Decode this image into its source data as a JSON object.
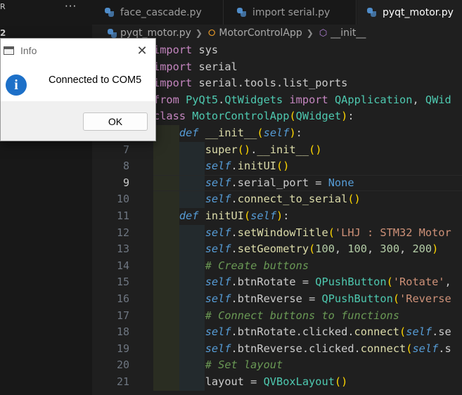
{
  "sidebar": {
    "title": "R",
    "more": "···",
    "badge": "2"
  },
  "tabs": [
    {
      "label": "face_cascade.py",
      "active": false
    },
    {
      "label": "import serial.py",
      "active": false
    },
    {
      "label": "pyqt_motor.py",
      "active": true
    }
  ],
  "breadcrumb": {
    "file": "pyqt_motor.py",
    "class": "MotorControlApp",
    "method": "__init__"
  },
  "editor": {
    "current_line": 9,
    "lines": [
      {
        "n": "",
        "text": "import sys"
      },
      {
        "n": "",
        "text": "import serial"
      },
      {
        "n": "",
        "text": "import serial.tools.list_ports"
      },
      {
        "n": "",
        "text": "from PyQt5.QtWidgets import QApplication, QWid"
      },
      {
        "n": "",
        "text": "class MotorControlApp(QWidget):"
      },
      {
        "n": "",
        "text": "    def __init__(self):"
      },
      {
        "n": "7",
        "text": "        super().__init__()"
      },
      {
        "n": "8",
        "text": "        self.initUI()"
      },
      {
        "n": "9",
        "text": "        self.serial_port = None"
      },
      {
        "n": "10",
        "text": "        self.connect_to_serial()"
      },
      {
        "n": "11",
        "text": "    def initUI(self):"
      },
      {
        "n": "12",
        "text": "        self.setWindowTitle('LHJ : STM32 Motor"
      },
      {
        "n": "13",
        "text": "        self.setGeometry(100, 100, 300, 200)"
      },
      {
        "n": "14",
        "text": "        # Create buttons"
      },
      {
        "n": "15",
        "text": "        self.btnRotate = QPushButton('Rotate',"
      },
      {
        "n": "16",
        "text": "        self.btnReverse = QPushButton('Reverse"
      },
      {
        "n": "17",
        "text": "        # Connect buttons to functions"
      },
      {
        "n": "18",
        "text": "        self.btnRotate.clicked.connect(self.se"
      },
      {
        "n": "19",
        "text": "        self.btnReverse.clicked.connect(self.s"
      },
      {
        "n": "20",
        "text": "        # Set layout"
      },
      {
        "n": "21",
        "text": "        layout = QVBoxLayout()"
      }
    ]
  },
  "dialog": {
    "title": "Info",
    "message": "Connected to COM5",
    "ok_label": "OK",
    "icon": "info-icon",
    "close_icon": "close-icon"
  },
  "colors": {
    "editor_bg": "#1f1f1f",
    "sidebar_bg": "#181818",
    "keyword": "#c586c0",
    "function": "#dcdcaa",
    "class": "#4ec9b0",
    "string": "#ce9178",
    "number": "#b5cea8",
    "comment": "#6a9955",
    "info_blue": "#1d70c8"
  }
}
